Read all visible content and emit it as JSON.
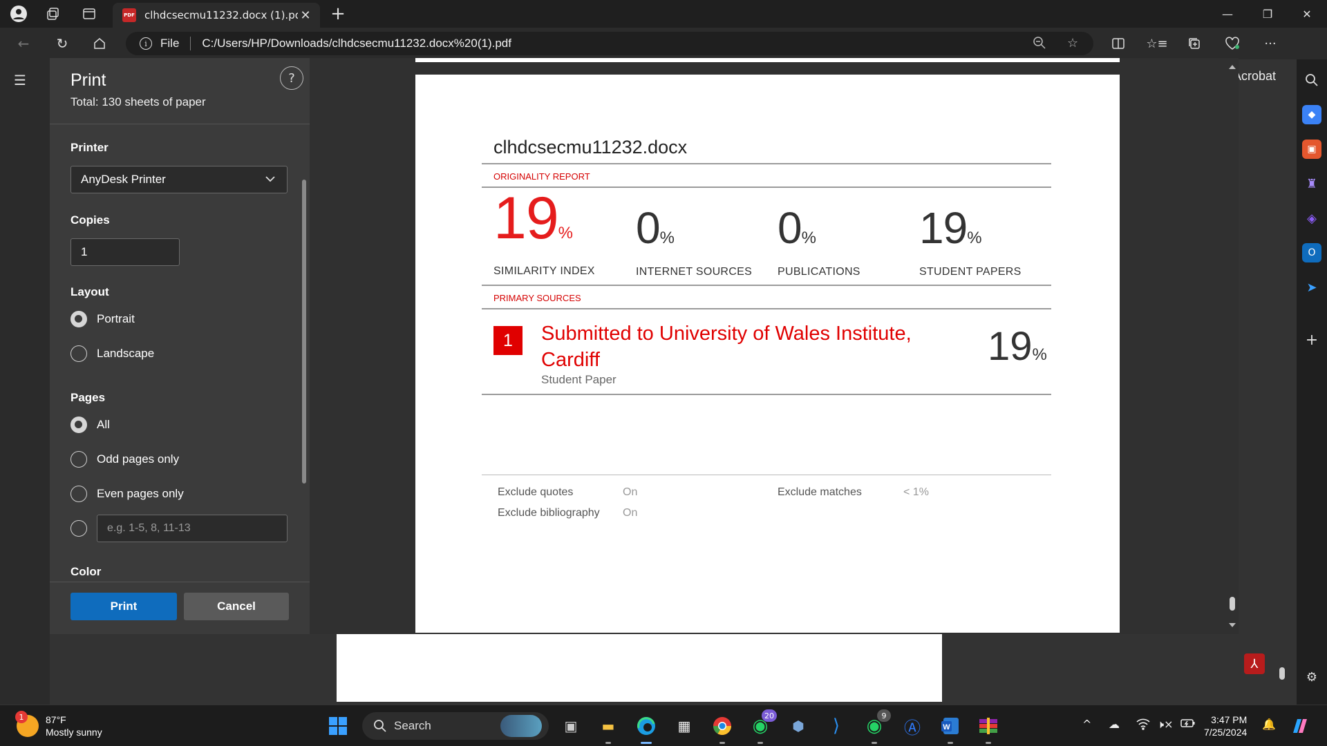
{
  "browser": {
    "tab_title": "clhdcsecmu11232.docx (1).pdf",
    "tab_icon_text": "PDF",
    "address_scheme": "File",
    "address_url": "C:/Users/HP/Downloads/clhdcsecmu11232.docx%20(1).pdf",
    "acrobat_label": "Acrobat"
  },
  "print_dialog": {
    "title": "Print",
    "total": "Total: 130 sheets of paper",
    "help": "?",
    "printer_label": "Printer",
    "printer_value": "AnyDesk Printer",
    "copies_label": "Copies",
    "copies_value": "1",
    "layout_label": "Layout",
    "layout_options": [
      "Portrait",
      "Landscape"
    ],
    "layout_selected": "Portrait",
    "pages_label": "Pages",
    "pages_options": [
      "All",
      "Odd pages only",
      "Even pages only"
    ],
    "pages_selected": "All",
    "pages_range_placeholder": "e.g. 1-5, 8, 11-13",
    "color_label": "Color",
    "print_button": "Print",
    "cancel_button": "Cancel"
  },
  "report": {
    "doc_title": "clhdcsecmu11232.docx",
    "originality_label": "ORIGINALITY REPORT",
    "stats": [
      {
        "value": "19",
        "unit": "%",
        "caption": "SIMILARITY INDEX"
      },
      {
        "value": "0",
        "unit": "%",
        "caption": "INTERNET SOURCES"
      },
      {
        "value": "0",
        "unit": "%",
        "caption": "PUBLICATIONS"
      },
      {
        "value": "19",
        "unit": "%",
        "caption": "STUDENT PAPERS"
      }
    ],
    "primary_label": "PRIMARY SOURCES",
    "source": {
      "number": "1",
      "title": "Submitted to University of Wales Institute, Cardiff",
      "type": "Student Paper",
      "value": "19",
      "unit": "%"
    },
    "exclude": {
      "quotes_label": "Exclude quotes",
      "quotes_value": "On",
      "bibliography_label": "Exclude bibliography",
      "bibliography_value": "On",
      "matches_label": "Exclude matches",
      "matches_value": "< 1%"
    }
  },
  "taskbar": {
    "weather_badge": "1",
    "temperature": "87°F",
    "weather_desc": "Mostly sunny",
    "search_label": "Search",
    "whatsapp_badge": "20",
    "whatsapp2_badge": "9",
    "time": "3:47 PM",
    "date": "7/25/2024"
  },
  "colors": {
    "accent_blue": "#0f6cbd",
    "report_red": "#e00000"
  }
}
